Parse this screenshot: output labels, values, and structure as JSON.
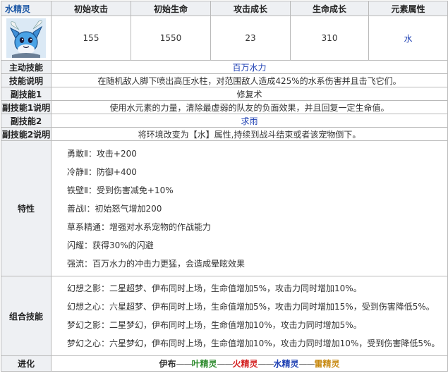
{
  "pet": {
    "name": "水精灵",
    "image_icon": "vaporeon-pet-portrait"
  },
  "stats": {
    "headers": [
      "初始攻击",
      "初始生命",
      "攻击成长",
      "生命成长",
      "元素属性"
    ],
    "values": [
      "155",
      "1550",
      "23",
      "310",
      "水"
    ]
  },
  "skills": {
    "active_label": "主动技能",
    "active_value": "百万水力",
    "active_desc_label": "技能说明",
    "active_desc": "在随机敌人脚下喷出高压水柱，对范围敌人造成425%的水系伤害并且击飞它们。",
    "sub1_label": "副技能1",
    "sub1_value": "修复术",
    "sub1_desc_label": "副技能1说明",
    "sub1_desc": "使用水元素的力量，清除最虚弱的队友的负面效果，并且回复一定生命值。",
    "sub2_label": "副技能2",
    "sub2_value": "求雨",
    "sub2_desc_label": "副技能2说明",
    "sub2_desc": "将环境改变为【水】属性,持续到战斗结束或者该宠物倒下。"
  },
  "traits": {
    "label": "特性",
    "items": [
      "勇敢Ⅱ：攻击+200",
      "冷静Ⅱ：防御+400",
      "铁壁Ⅱ：受到伤害减免+10%",
      "善战Ⅰ：初始怒气增加200",
      "草系精通：增强对水系宠物的作战能力",
      "闪耀：获得30%的闪避",
      "强流：百万水力的冲击力更猛，会造成晕眩效果"
    ]
  },
  "combos": {
    "label": "组合技能",
    "items": [
      "幻想之影：二星超梦、伊布同时上场，生命值增加5%，攻击力同时增加10%。",
      "幻想之心：六星超梦、伊布同时上场，生命值增加5%，攻击力同时增加15%，受到伤害降低5%。",
      "梦幻之影：二星梦幻，伊布同时上场，生命值增加10%，攻击力同时增加5%。",
      "梦幻之心：六星梦幻，伊布同时上场，生命值增加10%，攻击力同时增加10%，受到伤害降低5%。"
    ]
  },
  "evolution": {
    "label": "进化",
    "dash": "——",
    "chain": [
      {
        "name": "伊布",
        "color": "#333333"
      },
      {
        "name": "叶精灵",
        "color": "#2e8b2e"
      },
      {
        "name": "火精灵",
        "color": "#d42020"
      },
      {
        "name": "水精灵",
        "color": "#1d3fb3"
      },
      {
        "name": "雷精灵",
        "color": "#c88a12"
      }
    ]
  },
  "colors": {
    "header_bg": "#eef0f3",
    "border": "#b9b9b9",
    "name_blue": "#1d58a6",
    "skill_blue": "#1d3fb3"
  }
}
